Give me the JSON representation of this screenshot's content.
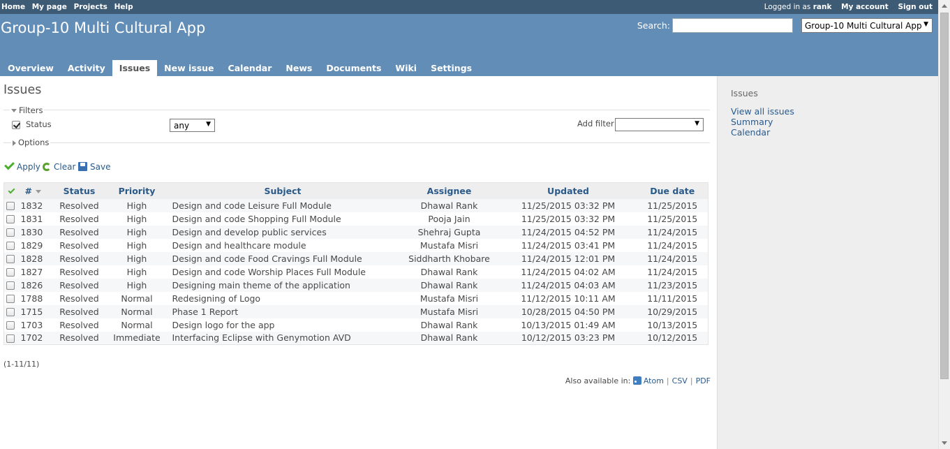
{
  "top_menu": {
    "left": [
      "Home",
      "My page",
      "Projects",
      "Help"
    ],
    "logged_prefix": "Logged in as",
    "user": "rank",
    "my_account": "My account",
    "sign_out": "Sign out"
  },
  "header": {
    "project_title": "Group-10 Multi Cultural App",
    "search_label": "Search:",
    "project_select": "Group-10 Multi Cultural App",
    "tabs": [
      "Overview",
      "Activity",
      "Issues",
      "New issue",
      "Calendar",
      "News",
      "Documents",
      "Wiki",
      "Settings"
    ],
    "selected_tab": "Issues"
  },
  "main": {
    "heading": "Issues",
    "filters_label": "Filters",
    "status_label": "Status",
    "status_value": "any",
    "add_filter_label": "Add filter",
    "add_filter_value": "",
    "options_label": "Options",
    "apply": "Apply",
    "clear": "Clear",
    "save": "Save",
    "columns": [
      "#",
      "Status",
      "Priority",
      "Subject",
      "Assignee",
      "Updated",
      "Due date"
    ],
    "rows": [
      {
        "id": "1832",
        "status": "Resolved",
        "priority": "High",
        "subject": "Design and code Leisure Full Module",
        "assignee": "Dhawal Rank",
        "updated": "11/25/2015 03:32 PM",
        "due": "11/25/2015"
      },
      {
        "id": "1831",
        "status": "Resolved",
        "priority": "High",
        "subject": "Design and code Shopping Full Module",
        "assignee": "Pooja Jain",
        "updated": "11/25/2015 03:32 PM",
        "due": "11/25/2015"
      },
      {
        "id": "1830",
        "status": "Resolved",
        "priority": "High",
        "subject": "Design and develop public services",
        "assignee": "Shehraj Gupta",
        "updated": "11/24/2015 04:52 PM",
        "due": "11/24/2015"
      },
      {
        "id": "1829",
        "status": "Resolved",
        "priority": "High",
        "subject": "Design and healthcare module",
        "assignee": "Mustafa Misri",
        "updated": "11/24/2015 03:41 PM",
        "due": "11/24/2015"
      },
      {
        "id": "1828",
        "status": "Resolved",
        "priority": "High",
        "subject": "Design and code Food Cravings Full Module",
        "assignee": "Siddharth Khobare",
        "updated": "11/24/2015 12:01 PM",
        "due": "11/24/2015"
      },
      {
        "id": "1827",
        "status": "Resolved",
        "priority": "High",
        "subject": "Design and code Worship Places Full Module",
        "assignee": "Dhawal Rank",
        "updated": "11/24/2015 04:02 AM",
        "due": "11/24/2015"
      },
      {
        "id": "1826",
        "status": "Resolved",
        "priority": "High",
        "subject": "Designing main theme of the application",
        "assignee": "Dhawal Rank",
        "updated": "11/24/2015 04:03 AM",
        "due": "11/23/2015"
      },
      {
        "id": "1788",
        "status": "Resolved",
        "priority": "Normal",
        "subject": "Redesigning of Logo",
        "assignee": "Mustafa Misri",
        "updated": "11/12/2015 10:11 AM",
        "due": "11/11/2015"
      },
      {
        "id": "1715",
        "status": "Resolved",
        "priority": "Normal",
        "subject": "Phase 1 Report",
        "assignee": "Mustafa Misri",
        "updated": "10/28/2015 04:50 PM",
        "due": "10/29/2015"
      },
      {
        "id": "1703",
        "status": "Resolved",
        "priority": "Normal",
        "subject": "Design logo for the app",
        "assignee": "Dhawal Rank",
        "updated": "10/13/2015 01:49 AM",
        "due": "10/13/2015"
      },
      {
        "id": "1702",
        "status": "Resolved",
        "priority": "Immediate",
        "subject": "Interfacing Eclipse with Genymotion AVD",
        "assignee": "Dhawal Rank",
        "updated": "10/12/2015 03:23 PM",
        "due": "10/12/2015"
      }
    ],
    "pagination": "(1-11/11)",
    "also_available": "Also available in:",
    "formats": [
      "Atom",
      "CSV",
      "PDF"
    ]
  },
  "sidebar": {
    "title": "Issues",
    "links": [
      "View all issues",
      "Summary",
      "Calendar"
    ]
  }
}
